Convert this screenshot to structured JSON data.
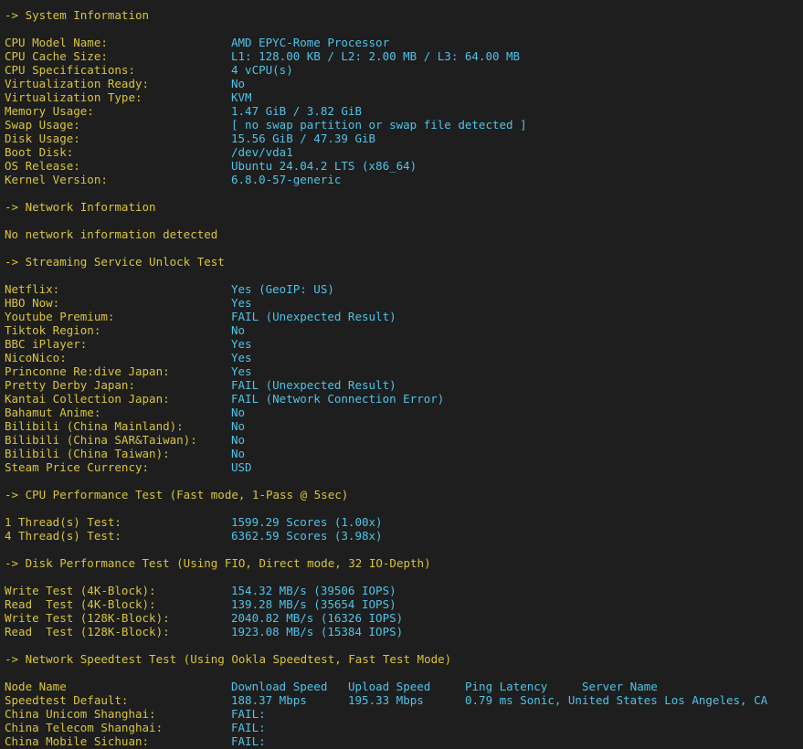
{
  "sections": {
    "system": {
      "heading": "-> System Information",
      "rows": [
        {
          "key": "CPU Model Name:",
          "value": "AMD EPYC-Rome Processor"
        },
        {
          "key": "CPU Cache Size:",
          "value": "L1: 128.00 KB / L2: 2.00 MB / L3: 64.00 MB"
        },
        {
          "key": "CPU Specifications:",
          "value": "4 vCPU(s)"
        },
        {
          "key": "Virtualization Ready:",
          "value": "No"
        },
        {
          "key": "Virtualization Type:",
          "value": "KVM"
        },
        {
          "key": "Memory Usage:",
          "value": "1.47 GiB / 3.82 GiB"
        },
        {
          "key": "Swap Usage:",
          "value": "[ no swap partition or swap file detected ]"
        },
        {
          "key": "Disk Usage:",
          "value": "15.56 GiB / 47.39 GiB"
        },
        {
          "key": "Boot Disk:",
          "value": "/dev/vda1"
        },
        {
          "key": "OS Release:",
          "value": "Ubuntu 24.04.2 LTS (x86_64)"
        },
        {
          "key": "Kernel Version:",
          "value": "6.8.0-57-generic"
        }
      ]
    },
    "network": {
      "heading": "-> Network Information",
      "message": "No network information detected"
    },
    "streaming": {
      "heading": "-> Streaming Service Unlock Test",
      "rows": [
        {
          "key": "Netflix:",
          "value": "Yes (GeoIP: US)"
        },
        {
          "key": "HBO Now:",
          "value": "Yes"
        },
        {
          "key": "Youtube Premium:",
          "value": "FAIL (Unexpected Result)"
        },
        {
          "key": "Tiktok Region:",
          "value": "No"
        },
        {
          "key": "BBC iPlayer:",
          "value": "Yes"
        },
        {
          "key": "NicoNico:",
          "value": "Yes"
        },
        {
          "key": "Princonne Re:dive Japan:",
          "value": "Yes"
        },
        {
          "key": "Pretty Derby Japan:",
          "value": "FAIL (Unexpected Result)"
        },
        {
          "key": "Kantai Collection Japan:",
          "value": "FAIL (Network Connection Error)"
        },
        {
          "key": "Bahamut Anime:",
          "value": "No"
        },
        {
          "key": "Bilibili (China Mainland):",
          "value": "No"
        },
        {
          "key": "Bilibili (China SAR&Taiwan):",
          "value": "No"
        },
        {
          "key": "Bilibili (China Taiwan):",
          "value": "No"
        },
        {
          "key": "Steam Price Currency:",
          "value": "USD"
        }
      ]
    },
    "cpu": {
      "heading": "-> CPU Performance Test (Fast mode, 1-Pass @ 5sec)",
      "rows": [
        {
          "key": "1 Thread(s) Test:",
          "value": "1599.29 Scores (1.00x)"
        },
        {
          "key": "4 Thread(s) Test:",
          "value": "6362.59 Scores (3.98x)"
        }
      ]
    },
    "disk": {
      "heading": "-> Disk Performance Test (Using FIO, Direct mode, 32 IO-Depth)",
      "rows": [
        {
          "key": "Write Test (4K-Block):",
          "value": "154.32 MB/s (39506 IOPS)"
        },
        {
          "key": "Read  Test (4K-Block):",
          "value": "139.28 MB/s (35654 IOPS)"
        },
        {
          "key": "Write Test (128K-Block):",
          "value": "2040.82 MB/s (16326 IOPS)"
        },
        {
          "key": "Read  Test (128K-Block):",
          "value": "1923.08 MB/s (15384 IOPS)"
        }
      ]
    },
    "speedtest": {
      "heading": "-> Network Speedtest Test (Using Ookla Speedtest, Fast Test Mode)",
      "columns": {
        "node": "Node Name",
        "download": "Download Speed",
        "upload": "Upload Speed",
        "ping": "Ping Latency",
        "server": "Server Name"
      },
      "rows": [
        {
          "node": "Speedtest Default:",
          "download": "188.37 Mbps",
          "upload": "195.33 Mbps",
          "ping": "0.79 ms",
          "server": "Sonic, United States Los Angeles, CA"
        },
        {
          "node": "China Unicom Shanghai:",
          "download": "FAIL:",
          "upload": "",
          "ping": "",
          "server": ""
        },
        {
          "node": "China Telecom Shanghai:",
          "download": "FAIL:",
          "upload": "",
          "ping": "",
          "server": ""
        },
        {
          "node": "China Mobile Sichuan:",
          "download": "FAIL:",
          "upload": "",
          "ping": "",
          "server": ""
        }
      ]
    }
  }
}
